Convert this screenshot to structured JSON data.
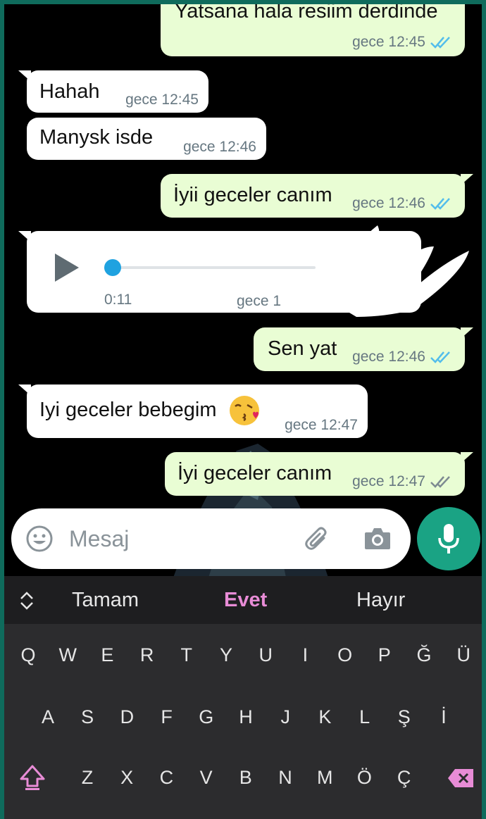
{
  "messages": [
    {
      "dir": "out",
      "text": "Yatsana hala resiim derdinde",
      "time": "gece 12:45",
      "ticks": "read"
    },
    {
      "dir": "in",
      "text": "Hahah",
      "time": "gece 12:45"
    },
    {
      "dir": "in",
      "text": "Manysk isde",
      "time": "gece 12:46"
    },
    {
      "dir": "out",
      "text": "İyii geceler canım",
      "time": "gece 12:46",
      "ticks": "read"
    },
    {
      "dir": "in",
      "type": "voice",
      "duration": "0:11",
      "time": "gece 1"
    },
    {
      "dir": "out",
      "text": "Sen yat",
      "time": "gece 12:46",
      "ticks": "read"
    },
    {
      "dir": "in",
      "text": "Iyi geceler bebegim",
      "emoji": "kissing-face-with-heart",
      "time": "gece 12:47"
    },
    {
      "dir": "out",
      "text": "İyi geceler canım",
      "time": "gece 12:47",
      "ticks": "delivered"
    }
  ],
  "composer": {
    "placeholder": "Mesaj"
  },
  "suggestions": [
    "Tamam",
    "Evet",
    "Hayır"
  ],
  "keyboard": {
    "row1": [
      "Q",
      "W",
      "E",
      "R",
      "T",
      "Y",
      "U",
      "I",
      "O",
      "P",
      "Ğ",
      "Ü"
    ],
    "row2": [
      "A",
      "S",
      "D",
      "F",
      "G",
      "H",
      "J",
      "K",
      "L",
      "Ş",
      "İ"
    ],
    "row3": [
      "Z",
      "X",
      "C",
      "V",
      "B",
      "N",
      "M",
      "Ö",
      "Ç"
    ]
  },
  "colors": {
    "accent": "#1aa384",
    "outgoing": "#e9fdd4",
    "incoming": "#ffffff",
    "read_ticks": "#53bdeb",
    "suggestion_highlight": "#e88cd6"
  }
}
